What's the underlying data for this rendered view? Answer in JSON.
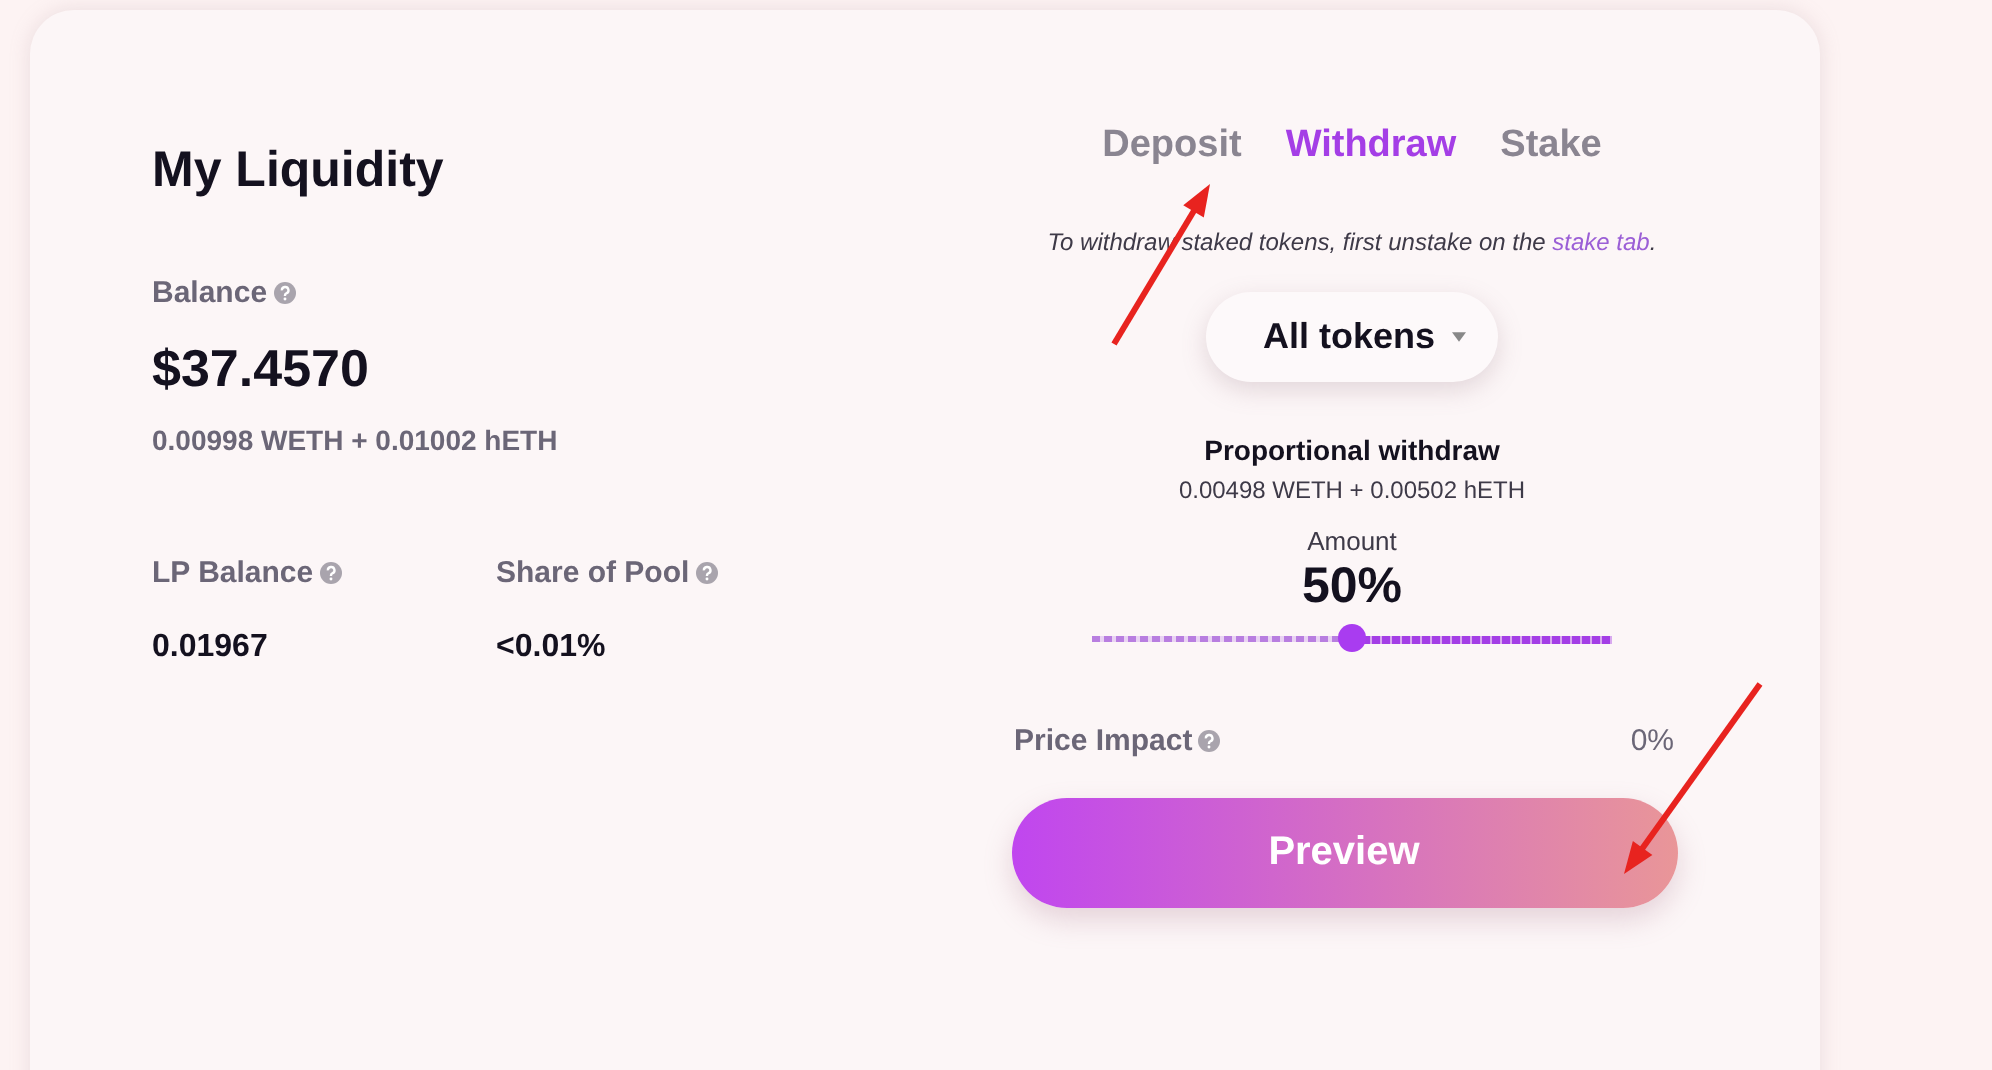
{
  "title": "My Liquidity",
  "balance": {
    "label": "Balance",
    "value": "$37.4570",
    "breakdown": "0.00998 WETH + 0.01002 hETH"
  },
  "stats": [
    {
      "label": "LP Balance",
      "value": "0.01967"
    },
    {
      "label": "Share of Pool",
      "value": "<0.01%"
    }
  ],
  "tabs": [
    {
      "label": "Deposit",
      "selected": false
    },
    {
      "label": "Withdraw",
      "selected": true
    },
    {
      "label": "Stake",
      "selected": false
    }
  ],
  "note": {
    "text": "To withdraw staked tokens, first unstake on the ",
    "link": "stake tab",
    "end": "."
  },
  "token_select": {
    "value": "All tokens"
  },
  "withdraw": {
    "title": "Proportional withdraw",
    "breakdown": "0.00498 WETH + 0.00502 hETH"
  },
  "amount": {
    "label": "Amount",
    "value": "50%",
    "level": 0.5
  },
  "price_impact": {
    "label": "Price Impact",
    "value": "0%"
  },
  "buttons": [
    "Preview"
  ],
  "annotations": [
    {
      "kind": "arrow"
    },
    {
      "kind": "arrow"
    }
  ]
}
